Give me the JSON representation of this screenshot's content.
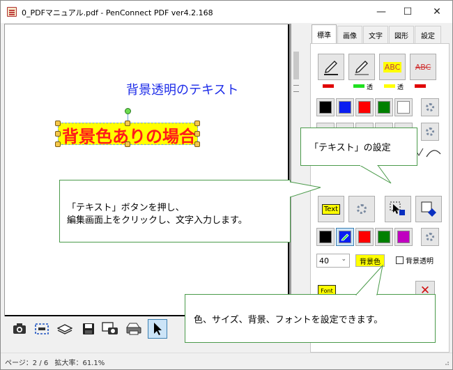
{
  "window": {
    "title": "0_PDFマニュアル.pdf - PenConnect PDF ver4.2.168",
    "minimize": "—",
    "maximize": "☐",
    "close": "✕"
  },
  "document": {
    "transparent_text": "背景透明のテキスト",
    "background_text": "背景色ありの場合"
  },
  "callouts": {
    "text_settings": "「テキスト」の設定",
    "text_button_line1": "「テキスト」ボタンを押し、",
    "text_button_line2": "編集画面上をクリックし、文字入力します。",
    "color_size": "色、サイズ、背景、フォントを設定できます。"
  },
  "status": {
    "page": "ページ：2 / 6",
    "zoom": "拡大率：61.1%"
  },
  "panel": {
    "tabs": [
      "標準",
      "画像",
      "文字",
      "図形",
      "設定"
    ],
    "active_tab": "標準",
    "pen_labels": {
      "transparent_1": "透",
      "transparent_2": "透",
      "highlighter": "ABC",
      "strike": "ABC"
    },
    "text_button": "Text",
    "font_size": "40",
    "bg_color_label": "背景色",
    "bg_transparent_label": "背景透明",
    "font_button": "Font",
    "delete_icon": "✕"
  },
  "colors": {
    "palette_1": [
      "#000000",
      "#0a1ef0",
      "#ff0000",
      "#008000",
      "#ffffff"
    ],
    "palette_2": [
      "#000000",
      "#0a1ef0",
      "#ff0000",
      "#008000",
      "#c000c0"
    ],
    "pen_bars": [
      "#e00000",
      "#20e020",
      "#ffff00",
      "#e00000"
    ],
    "accent_text": "#1c2be8",
    "bg_text": "#ff1a1a",
    "bg_highlight": "#ffff00"
  }
}
